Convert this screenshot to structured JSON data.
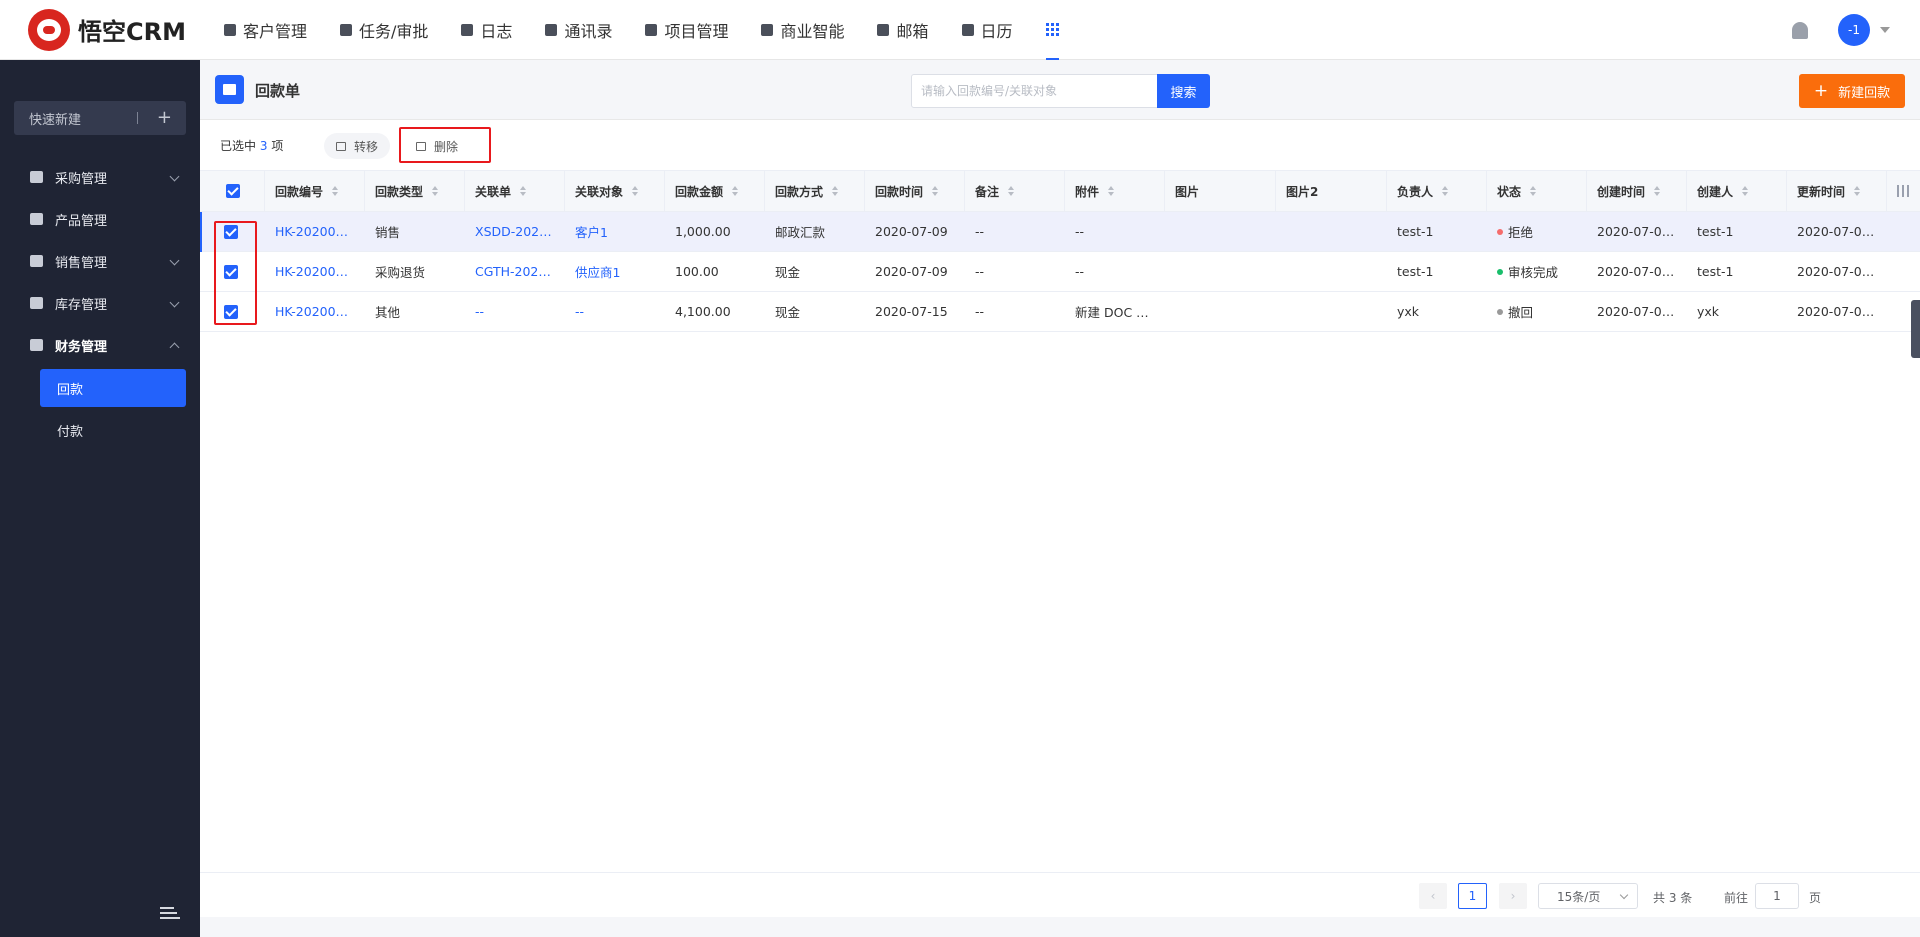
{
  "app": {
    "logo_text": "悟空CRM"
  },
  "nav": {
    "items": [
      {
        "label": "客户管理",
        "icon": "building-icon"
      },
      {
        "label": "任务/审批",
        "icon": "briefcase-icon"
      },
      {
        "label": "日志",
        "icon": "journal-icon"
      },
      {
        "label": "通讯录",
        "icon": "phone-icon"
      },
      {
        "label": "项目管理",
        "icon": "list-icon"
      },
      {
        "label": "商业智能",
        "icon": "shield-icon"
      },
      {
        "label": "邮箱",
        "icon": "mail-icon"
      },
      {
        "label": "日历",
        "icon": "calendar-icon"
      }
    ],
    "apps_icon": "grid-icon",
    "avatar_text": "-1"
  },
  "sidebar": {
    "quick_new_label": "快速新建",
    "items": [
      {
        "label": "采购管理",
        "icon": "cart-icon"
      },
      {
        "label": "产品管理",
        "icon": "box-icon"
      },
      {
        "label": "销售管理",
        "icon": "tag-icon"
      },
      {
        "label": "库存管理",
        "icon": "warehouse-icon"
      },
      {
        "label": "财务管理",
        "icon": "wallet-icon"
      }
    ],
    "sub_items": [
      {
        "label": "回款",
        "active": true
      },
      {
        "label": "付款",
        "active": false
      }
    ]
  },
  "page": {
    "title": "回款单",
    "search_placeholder": "请输入回款编号/关联对象",
    "search_button": "搜索",
    "new_button": "新建回款"
  },
  "toolbar": {
    "selected_prefix": "已选中",
    "selected_count": "3",
    "selected_suffix": "项",
    "transfer_label": "转移",
    "delete_label": "删除"
  },
  "table": {
    "columns": [
      "回款编号",
      "回款类型",
      "关联单",
      "关联对象",
      "回款金额",
      "回款方式",
      "回款时间",
      "备注",
      "附件",
      "图片",
      "图片2",
      "负责人",
      "状态",
      "创建时间",
      "创建人",
      "更新时间"
    ],
    "rows": [
      {
        "code": "HK-20200…",
        "type": "销售",
        "order": "XSDD-202…",
        "target": "客户1",
        "amount": "1,000.00",
        "method": "邮政汇款",
        "date": "2020-07-09",
        "note": "--",
        "attachment": "--",
        "image": "",
        "image2": "",
        "owner": "test-1",
        "status": "拒绝",
        "status_color": "#f56c6c",
        "created": "2020-07-0…",
        "creator": "test-1",
        "updated": "2020-07-0…"
      },
      {
        "code": "HK-20200…",
        "type": "采购退货",
        "order": "CGTH-202…",
        "target": "供应商1",
        "amount": "100.00",
        "method": "现金",
        "date": "2020-07-09",
        "note": "--",
        "attachment": "--",
        "image": "",
        "image2": "",
        "owner": "test-1",
        "status": "审核完成",
        "status_color": "#19be6b",
        "created": "2020-07-0…",
        "creator": "test-1",
        "updated": "2020-07-0…"
      },
      {
        "code": "HK-20200…",
        "type": "其他",
        "order": "--",
        "target": "--",
        "amount": "4,100.00",
        "method": "现金",
        "date": "2020-07-15",
        "note": "--",
        "attachment": "新建 DOC …",
        "image": "",
        "image2": "",
        "owner": "yxk",
        "status": "撤回",
        "status_color": "#999999",
        "created": "2020-07-0…",
        "creator": "yxk",
        "updated": "2020-07-0…"
      }
    ]
  },
  "pager": {
    "current_page": "1",
    "page_size": "15条/页",
    "total": "共 3 条",
    "goto_label": "前往",
    "goto_value": "1",
    "unit": "页"
  }
}
